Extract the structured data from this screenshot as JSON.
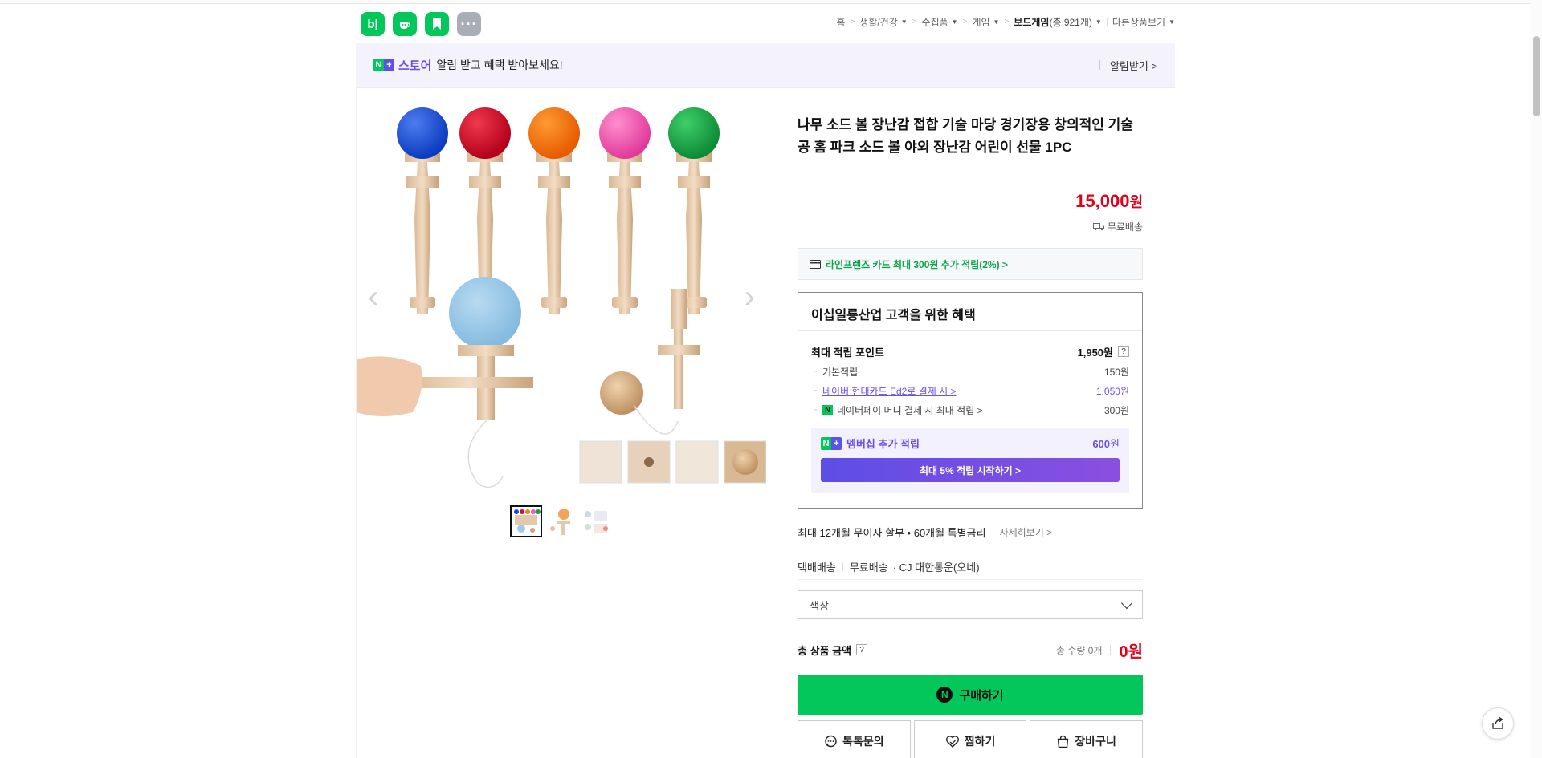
{
  "header": {
    "app_icons": [
      {
        "name": "blog",
        "label": "b|"
      },
      {
        "name": "cafe",
        "label": "☕"
      },
      {
        "name": "bookmark",
        "label": ""
      },
      {
        "name": "more",
        "label": "···"
      }
    ],
    "breadcrumb": [
      {
        "label": "홈",
        "dropdown": false
      },
      {
        "label": "생활/건강",
        "dropdown": true
      },
      {
        "label": "수집품",
        "dropdown": true
      },
      {
        "label": "게임",
        "dropdown": true
      },
      {
        "label": "보드게임",
        "count": "(총 921개)",
        "dropdown": true
      },
      {
        "label": "다른상품보기",
        "dropdown": true
      }
    ]
  },
  "banner": {
    "badge_n": "N",
    "badge_plus": "+",
    "store": "스토어",
    "message": "알림 받고 혜택 받아보세요!",
    "action": "알림받기 >"
  },
  "product": {
    "title": "나무 소드 볼 장난감 접합 기술 마당 경기장용 창의적인 기술 공 홈 파크 소드 볼 야외 장난감 어린이 선물 1PC",
    "price": "15,000",
    "price_unit": "원",
    "delivery": "무료배송",
    "card_offer": "라인프렌즈 카드 최대 300원 추가 적립(2%) >"
  },
  "benefits": {
    "heading": "이십일룡산업 고객을 위한 혜택",
    "max_points_label": "최대 적립 포인트",
    "max_points_value": "1,950원",
    "help": "?",
    "rows": [
      {
        "label": "기본적립",
        "value": "150원",
        "type": "plain"
      },
      {
        "label": "네이버 현대카드 Ed2로 결제 시 >",
        "value": "1,050원",
        "type": "link"
      },
      {
        "label": "네이버페이 머니 결제 시 최대 적립 >",
        "value": "300원",
        "type": "npay"
      }
    ],
    "membership_label": "멤버십 추가 적립",
    "membership_value": "600",
    "membership_unit": "원",
    "membership_cta": "최대 5% 적립 시작하기 >"
  },
  "installment": {
    "text": "최대 12개월 무이자 할부 • 60개월 특별금리",
    "more": "자세히보기 >"
  },
  "shipping": {
    "method": "택배배송",
    "fee": "무료배송",
    "carrier": "· CJ 대한통운(오네)"
  },
  "option": {
    "placeholder": "색상"
  },
  "total": {
    "label": "총 상품 금액",
    "help": "?",
    "quantity": "총 수량 0개",
    "amount": "0원"
  },
  "actions": {
    "buy": "구매하기",
    "buy_logo": "N",
    "talk": "톡톡문의",
    "wish": "찜하기",
    "cart": "장바구니"
  },
  "colors": {
    "naver_green": "#03c75a",
    "price_red": "#e3001b",
    "purple": "#6a4ded"
  }
}
